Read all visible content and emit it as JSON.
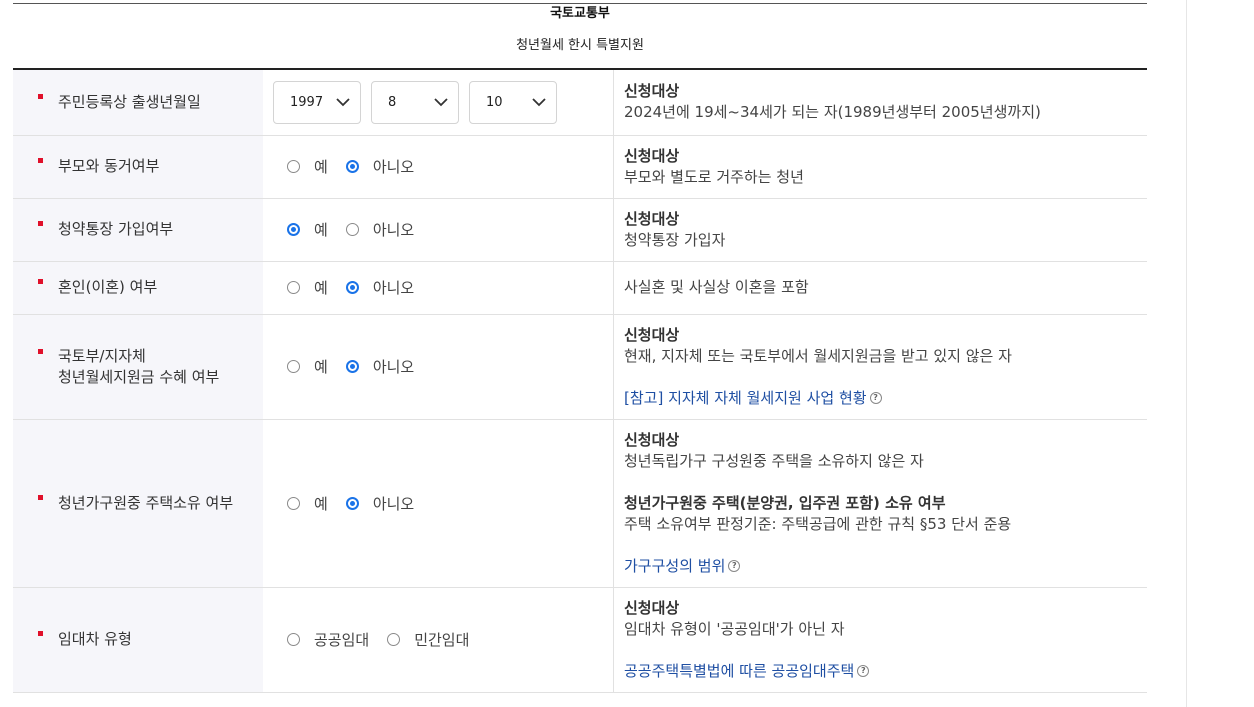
{
  "header": {
    "ministry": "국토교통부",
    "program": "청년월세 한시 특별지원"
  },
  "rows": {
    "birth": {
      "label": "주민등록상 출생년월일",
      "year": "1997",
      "month": "8",
      "day": "10",
      "info_title": "신청대상",
      "info_text": "2024년에 19세~34세가 되는 자(1989년생부터 2005년생까지)"
    },
    "parents": {
      "label": "부모와 동거여부",
      "opt_yes": "예",
      "opt_no": "아니오",
      "selected": "아니오",
      "info_title": "신청대상",
      "info_text": "부모와 별도로 거주하는 청년"
    },
    "subscription": {
      "label": "청약통장 가입여부",
      "opt_yes": "예",
      "opt_no": "아니오",
      "selected": "예",
      "info_title": "신청대상",
      "info_text": "청약통장 가입자"
    },
    "marriage": {
      "label": "혼인(이혼) 여부",
      "opt_yes": "예",
      "opt_no": "아니오",
      "selected": "아니오",
      "info_text": "사실혼 및 사실상 이혼을 포함"
    },
    "subsidy": {
      "label": "국토부/지자체\n청년월세지원금 수혜 여부",
      "opt_yes": "예",
      "opt_no": "아니오",
      "selected": "아니오",
      "info_title": "신청대상",
      "info_text": "현재, 지자체 또는 국토부에서 월세지원금을 받고 있지 않은 자",
      "link_text": "[참고] 지자체 자체 월세지원 사업 현황"
    },
    "housing": {
      "label": "청년가구원중 주택소유 여부",
      "opt_yes": "예",
      "opt_no": "아니오",
      "selected": "아니오",
      "info_title": "신청대상",
      "info_text": "청년독립가구 구성원중 주택을 소유하지 않은 자",
      "info_title2": "청년가구원중 주택(분양권, 입주권 포함) 소유 여부",
      "info_text2": "주택 소유여부 판정기준: 주택공급에 관한 규칙 §53 단서 준용",
      "link_text": "가구구성의 범위"
    },
    "lease": {
      "label": "임대차 유형",
      "opt_public": "공공임대",
      "opt_private": "민간임대",
      "selected": "",
      "info_title": "신청대상",
      "info_text": "임대차 유형이 '공공임대'가 아닌 자",
      "link_text": "공공주택특별법에 따른 공공임대주택"
    }
  },
  "colors": {
    "bullet": "#e0102a",
    "radio_selected": "#1a73e8",
    "link": "#1f4fa3",
    "label_bg": "#f6f6fa"
  },
  "icons": {
    "select_arrow": "chevron-down-icon",
    "help": "help-icon"
  }
}
